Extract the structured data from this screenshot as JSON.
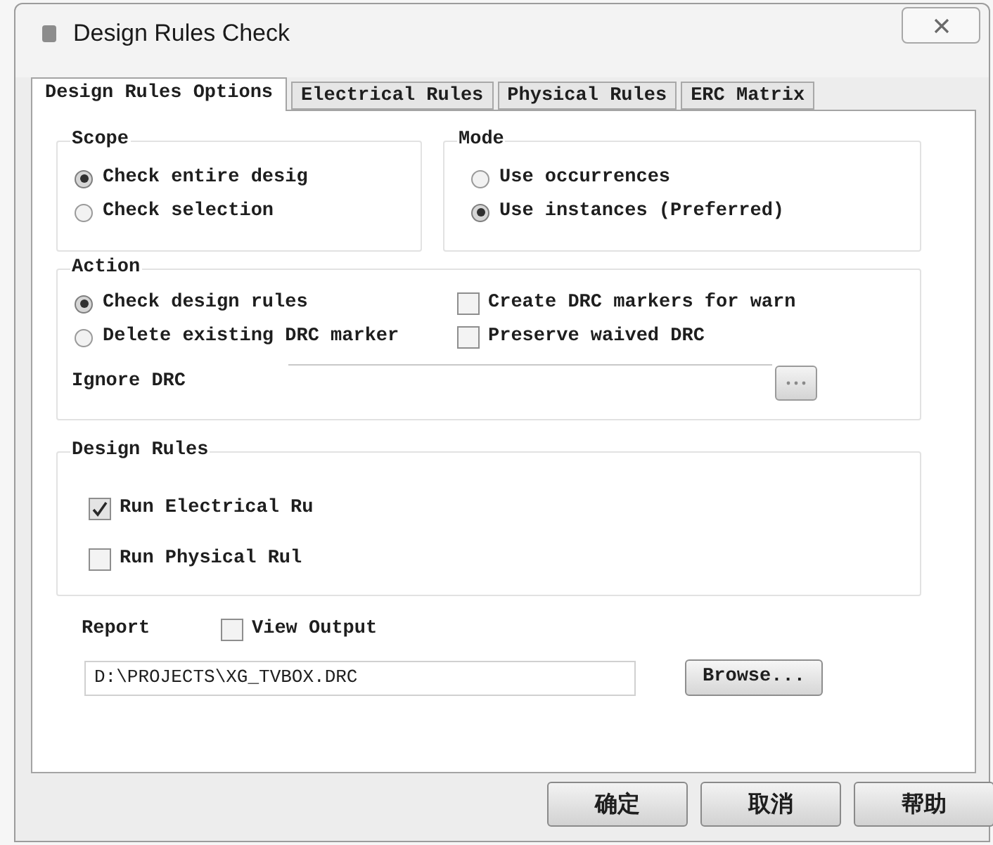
{
  "window": {
    "title": "Design Rules Check"
  },
  "tabs": [
    {
      "label": "Design Rules Options",
      "selected": true
    },
    {
      "label": "Electrical Rules",
      "selected": false
    },
    {
      "label": "Physical Rules",
      "selected": false
    },
    {
      "label": "ERC Matrix",
      "selected": false
    }
  ],
  "scope": {
    "label": "Scope",
    "options": [
      {
        "label": "Check entire desig",
        "selected": true
      },
      {
        "label": "Check selection",
        "selected": false
      }
    ]
  },
  "mode": {
    "label": "Mode",
    "options": [
      {
        "label": "Use occurrences",
        "selected": false
      },
      {
        "label": "Use instances (Preferred)",
        "selected": true
      }
    ]
  },
  "action": {
    "label": "Action",
    "options": [
      {
        "label": "Check design rules",
        "selected": true
      },
      {
        "label": "Delete existing DRC marker",
        "selected": false
      }
    ],
    "checkboxes": [
      {
        "label": "Create DRC markers for warn",
        "checked": false
      },
      {
        "label": "Preserve waived DRC",
        "checked": false
      }
    ],
    "ignore_drc": {
      "label": "Ignore DRC"
    }
  },
  "design_rules": {
    "label": "Design Rules",
    "checkboxes": [
      {
        "label": "Run Electrical Ru",
        "checked": true
      },
      {
        "label": "Run Physical Rul",
        "checked": false
      }
    ]
  },
  "report": {
    "label": "Report",
    "view_output": {
      "label": "View Output",
      "checked": false
    },
    "file": {
      "value": "D:\\PROJECTS\\XG_TVBOX.DRC"
    },
    "browse_button": "Browse..."
  },
  "buttons": [
    "确定",
    "取消",
    "帮助"
  ]
}
